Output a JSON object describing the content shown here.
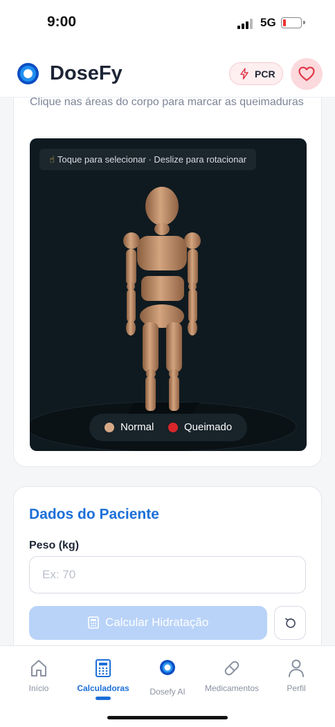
{
  "status_bar": {
    "time": "9:00",
    "network": "5G"
  },
  "header": {
    "app_name": "DoseFy",
    "pcr_label": "PCR"
  },
  "burn_card": {
    "instruction": "Clique nas áreas do corpo para marcar as queimaduras",
    "viewer_hint": "Toque para selecionar · Deslize para rotacionar",
    "legend": [
      {
        "label": "Normal",
        "color": "#d6a986"
      },
      {
        "label": "Queimado",
        "color": "#d9262b"
      }
    ]
  },
  "patient_card": {
    "title": "Dados do Paciente",
    "weight_label": "Peso (kg)",
    "weight_value": "",
    "weight_placeholder": "Ex: 70",
    "calculate_label": "Calcular Hidratação"
  },
  "tabbar": {
    "tabs": [
      {
        "label": "Início",
        "icon": "home-icon",
        "active": false
      },
      {
        "label": "Calculadoras",
        "icon": "calculator-icon",
        "active": true
      },
      {
        "label": "Dosefy AI",
        "icon": "dosefy-ai-icon",
        "active": false
      },
      {
        "label": "Medicamentos",
        "icon": "pill-icon",
        "active": false
      },
      {
        "label": "Perfil",
        "icon": "user-icon",
        "active": false
      }
    ]
  },
  "colors": {
    "accent": "#1c6fd8",
    "figure": "#c69570",
    "viewer_bg": "#0f1a20"
  }
}
